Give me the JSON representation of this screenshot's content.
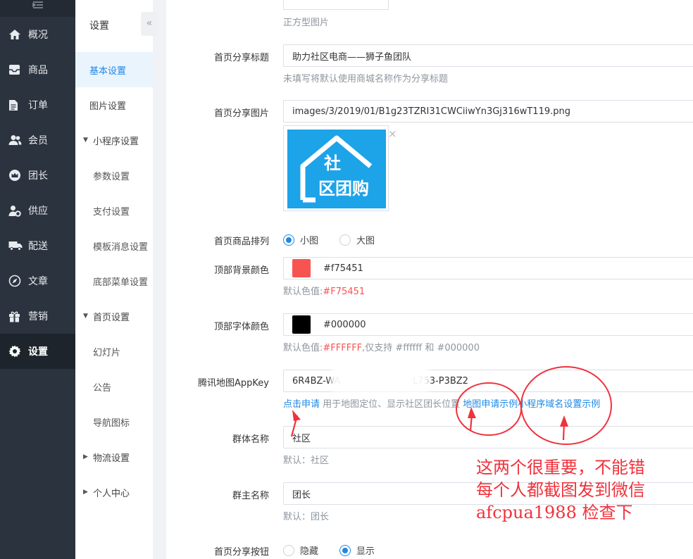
{
  "nav": {
    "top_icon": "list-collapse-icon",
    "items": [
      {
        "label": "概况",
        "icon": "home-icon"
      },
      {
        "label": "商品",
        "icon": "inbox-icon"
      },
      {
        "label": "订单",
        "icon": "file-icon"
      },
      {
        "label": "会员",
        "icon": "users-icon"
      },
      {
        "label": "团长",
        "icon": "crown-icon"
      },
      {
        "label": "供应",
        "icon": "user-gear-icon"
      },
      {
        "label": "配送",
        "icon": "truck-icon"
      },
      {
        "label": "文章",
        "icon": "compass-icon"
      },
      {
        "label": "营销",
        "icon": "gift-icon"
      },
      {
        "label": "设置",
        "icon": "gear-icon",
        "active": true
      }
    ]
  },
  "subnav": {
    "title": "设置",
    "collapse_glyph": "«",
    "items": [
      {
        "label": "基本设置",
        "active": true
      },
      {
        "label": "图片设置"
      },
      {
        "label": "小程序设置",
        "group": true,
        "expanded": true
      },
      {
        "label": "参数设置"
      },
      {
        "label": "支付设置"
      },
      {
        "label": "模板消息设置"
      },
      {
        "label": "底部菜单设置"
      },
      {
        "label": "首页设置",
        "group": true,
        "expanded": true
      },
      {
        "label": "幻灯片"
      },
      {
        "label": "公告"
      },
      {
        "label": "导航图标"
      },
      {
        "label": "物流设置",
        "group": true,
        "expanded": false
      },
      {
        "label": "个人中心",
        "group": true,
        "expanded": false
      }
    ]
  },
  "form": {
    "square_hint": "正方型图片",
    "share_title": {
      "label": "首页分享标题",
      "value": "助力社区电商——狮子鱼团队",
      "hint": "未填写将默认使用商城名称作为分享标题"
    },
    "share_image": {
      "label": "首页分享图片",
      "value": "images/3/2019/01/B1g23TZRI31CWCiiwYn3Gj316wT119.png",
      "thumb_text_1": "社",
      "thumb_text_2": "区团购",
      "close_glyph": "×"
    },
    "layout": {
      "label": "首页商品排列",
      "options": [
        "小图",
        "大图"
      ],
      "selected": "小图"
    },
    "bg_color": {
      "label": "顶部背景颜色",
      "value": "#f75451",
      "swatch": "#f75451",
      "hint_prefix": "默认色值:",
      "hint_value": "#F75451"
    },
    "font_color": {
      "label": "顶部字体颜色",
      "value": "#000000",
      "swatch": "#000000",
      "hint_prefix": "默认色值:",
      "hint_value": "#FFFFFF",
      "hint_suffix": ",仅支持 #ffffff 和 #000000"
    },
    "map_key": {
      "label": "腾讯地图AppKey",
      "value_start": "6R4BZ-WA",
      "value_end": "L753-P3BZ2",
      "apply_link": "点击申请",
      "hint_mid": " 用于地图定位、显示社区团长位置 ",
      "example_link_1": "地图申请示例",
      "example_link_2": "小程序域名设置示例"
    },
    "group_name": {
      "label": "群体名称",
      "value": "社区",
      "hint": "默认：社区"
    },
    "leader_name": {
      "label": "群主名称",
      "value": "团长",
      "hint": "默认：团长"
    },
    "share_button": {
      "label": "首页分享按钮",
      "options": [
        "隐藏",
        "显示"
      ],
      "selected": "显示"
    }
  },
  "annotation": {
    "line1": "这两个很重要，不能错",
    "line2": "每个人都截图发到微信",
    "line3": "afcpua1988 检查下",
    "color": "#f0323c"
  }
}
